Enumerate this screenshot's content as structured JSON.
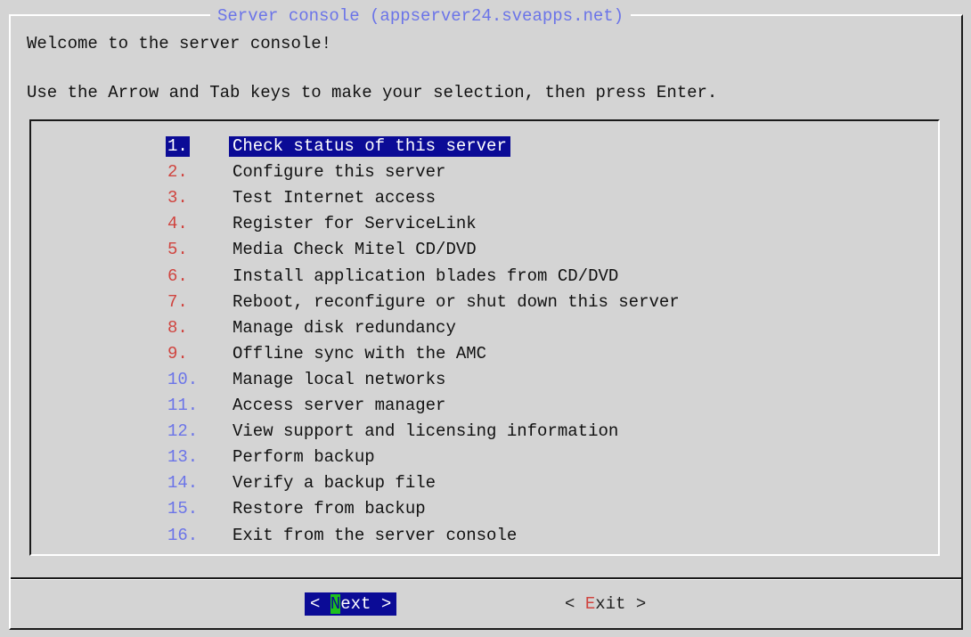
{
  "dialog": {
    "title": "Server console (appserver24.sveapps.net)",
    "welcome": "Welcome to the server console!",
    "instructions": "Use the Arrow and Tab keys to make your selection, then press Enter."
  },
  "menu": {
    "selected_index": 0,
    "items": [
      {
        "num": "1.",
        "label": "Check status of this server"
      },
      {
        "num": "2.",
        "label": "Configure this server"
      },
      {
        "num": "3.",
        "label": "Test Internet access"
      },
      {
        "num": "4.",
        "label": "Register for ServiceLink"
      },
      {
        "num": "5.",
        "label": "Media Check Mitel CD/DVD"
      },
      {
        "num": "6.",
        "label": "Install application blades from CD/DVD"
      },
      {
        "num": "7.",
        "label": "Reboot, reconfigure or shut down this server"
      },
      {
        "num": "8.",
        "label": "Manage disk redundancy"
      },
      {
        "num": "9.",
        "label": "Offline sync with the AMC"
      },
      {
        "num": "10.",
        "label": "Manage local networks"
      },
      {
        "num": "11.",
        "label": "Access server manager"
      },
      {
        "num": "12.",
        "label": "View support and licensing information"
      },
      {
        "num": "13.",
        "label": "Perform backup"
      },
      {
        "num": "14.",
        "label": "Verify a backup file"
      },
      {
        "num": "15.",
        "label": "Restore from backup"
      },
      {
        "num": "16.",
        "label": "Exit from the server console"
      }
    ]
  },
  "buttons": {
    "next": {
      "open": "< ",
      "hotkey": "N",
      "rest": "ext",
      "close": " >"
    },
    "exit": {
      "open": "< ",
      "hotkey": "E",
      "rest": "xit",
      "close": " >"
    }
  },
  "colors": {
    "background": "#d4d4d4",
    "selection": "#0b0b96",
    "title_blue": "#6b74e8",
    "number_red": "#d0443f",
    "hotkey_green": "#1ec01e"
  }
}
